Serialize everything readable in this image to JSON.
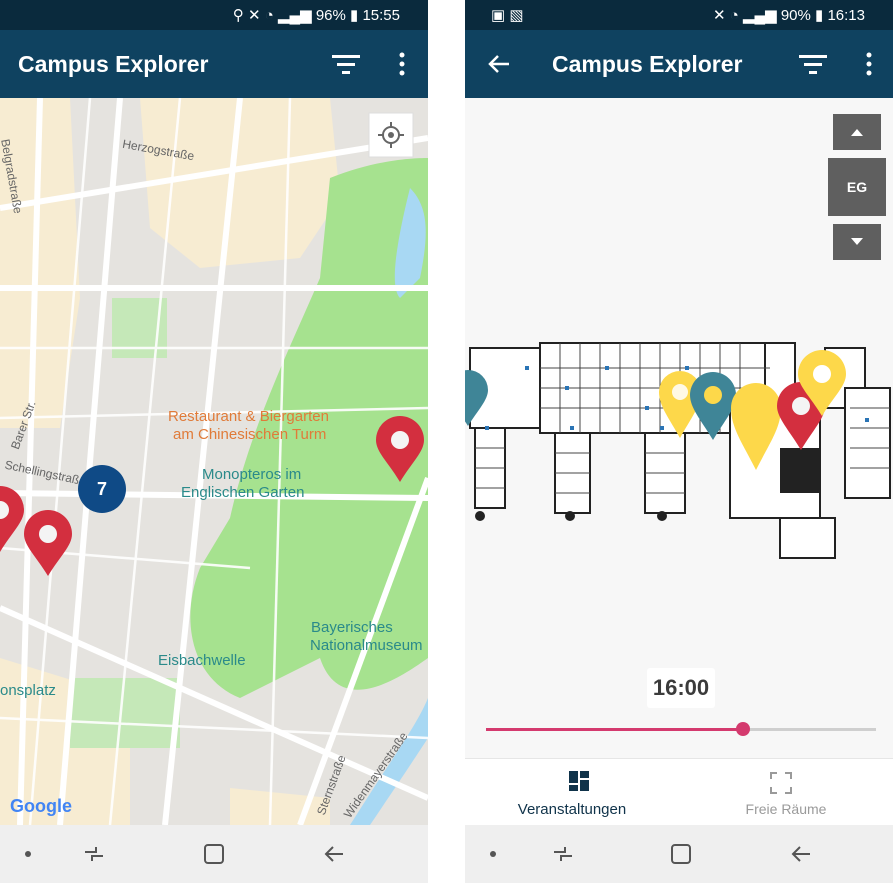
{
  "left": {
    "status": {
      "battery": "96%",
      "time": "15:55"
    },
    "appbar": {
      "title": "Campus Explorer"
    },
    "map": {
      "labels": {
        "herzog": "Herzogstraße",
        "belgrad": "Belgradstraße",
        "barer": "Barer Str.",
        "schelling": "Schellingstraße",
        "restaurant1": "Restaurant & Biergarten",
        "restaurant2": "am Chinesischen Turm",
        "monopteros1": "Monopteros im",
        "monopteros2": "Englischen Garten",
        "museum1": "Bayerisches",
        "museum2": "Nationalmuseum",
        "eisbach": "Eisbachwelle",
        "platz": "onsplatz",
        "stern": "Sternstraße",
        "widen": "Widenmayerstraße",
        "google": "Google",
        "cluster": "7"
      }
    }
  },
  "right": {
    "status": {
      "battery": "90%",
      "time": "16:13"
    },
    "appbar": {
      "title": "Campus Explorer"
    },
    "floor": {
      "level": "EG"
    },
    "time": {
      "value": "16:00",
      "slider_fraction": 0.66
    },
    "tabs": {
      "events": "Veranstaltungen",
      "rooms": "Freie Räume"
    }
  },
  "colors": {
    "appbar": "#0f4260",
    "statusbar": "#0a2a3d",
    "marker_red": "#d32f3f",
    "marker_yellow": "#fdd84a",
    "marker_teal": "#3f8597",
    "cluster": "#0f4a86",
    "slider": "#d43a6e"
  }
}
